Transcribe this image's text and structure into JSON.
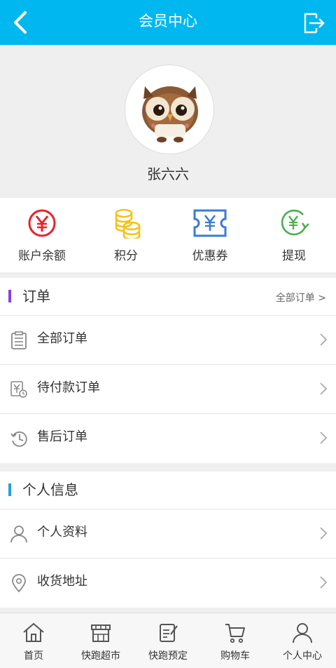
{
  "header": {
    "title": "会员中心"
  },
  "user": {
    "name": "张六六"
  },
  "quick_actions": [
    {
      "label": "账户余额",
      "icon": "yuan-circle-icon",
      "color": "#e8212b"
    },
    {
      "label": "积分",
      "icon": "coins-icon",
      "color": "#f4c318"
    },
    {
      "label": "优惠券",
      "icon": "coupon-icon",
      "color": "#3a7bd5"
    },
    {
      "label": "提现",
      "icon": "withdraw-icon",
      "color": "#4caf50"
    }
  ],
  "orders": {
    "title": "订单",
    "all_link": "全部订单 >",
    "accent": "#8a3ee6",
    "rows": [
      {
        "label": "全部订单",
        "icon": "clipboard-icon"
      },
      {
        "label": "待付款订单",
        "icon": "pending-payment-icon"
      },
      {
        "label": "售后订单",
        "icon": "after-sale-icon"
      }
    ]
  },
  "personal": {
    "title": "个人信息",
    "accent": "#1ba1e6",
    "rows": [
      {
        "label": "个人资料",
        "icon": "user-icon"
      },
      {
        "label": "收货地址",
        "icon": "location-icon"
      }
    ]
  },
  "tabs": [
    {
      "label": "首页",
      "icon": "home-icon"
    },
    {
      "label": "快跑超市",
      "icon": "store-icon"
    },
    {
      "label": "快跑预定",
      "icon": "reserve-icon"
    },
    {
      "label": "购物车",
      "icon": "cart-icon"
    },
    {
      "label": "个人中心",
      "icon": "profile-icon"
    }
  ]
}
